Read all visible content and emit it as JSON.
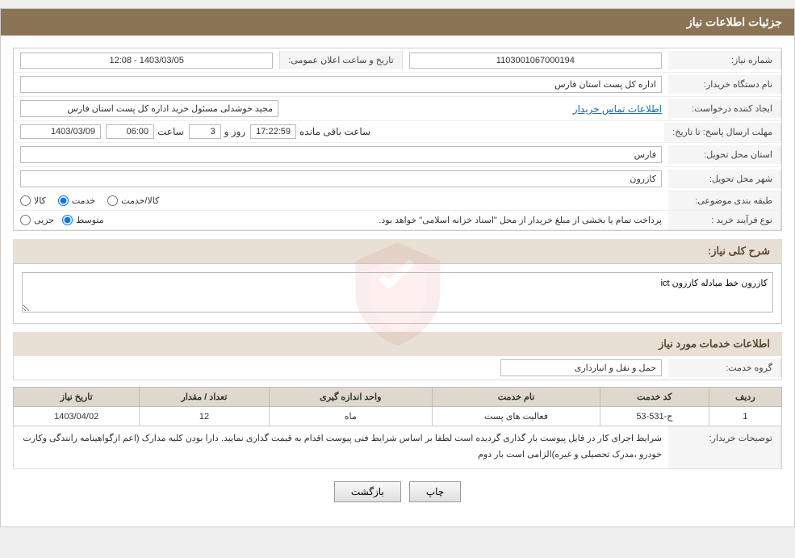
{
  "header": {
    "title": "جزئیات اطلاعات نیاز"
  },
  "fields": {
    "need_number_label": "شماره نیاز:",
    "need_number_value": "1103001067000194",
    "org_name_label": "نام دستگاه خریدار:",
    "org_name_value": "اداره کل پست استان فارس",
    "creator_label": "ایجاد کننده درخواست:",
    "creator_value": "مجید خوشدلی مسئول خرید اداره کل پست استان فارس",
    "contact_link": "اطلاعات تماس خریدار",
    "deadline_label": "مهلت ارسال پاسخ: تا تاریخ:",
    "deadline_date": "1403/03/09",
    "deadline_time_label": "ساعت",
    "deadline_time": "06:00",
    "deadline_days_label": "روز و",
    "deadline_days": "3",
    "deadline_remaining_label": "ساعت باقی مانده",
    "deadline_remaining": "17:22:59",
    "announce_label": "تاریخ و ساعت اعلان عمومی:",
    "announce_value": "1403/03/05 - 12:08",
    "province_label": "استان محل تحویل:",
    "province_value": "فارس",
    "city_label": "شهر محل تحویل:",
    "city_value": "کازرون",
    "category_label": "طبقه بندی موضوعی:",
    "category_options": [
      "کالا",
      "خدمت",
      "کالا/خدمت"
    ],
    "category_selected": "خدمت",
    "process_label": "نوع فرآیند خرید :",
    "process_options": [
      "جزیی",
      "متوسط"
    ],
    "process_note": "پرداخت تمام یا بخشی از مبلغ خریدار از محل \"اسناد خزانه اسلامی\" خواهد بود.",
    "need_desc_label": "شرح کلی نیاز:",
    "need_desc_value": "کازرون خط مبادله کازرون ict"
  },
  "service_section": {
    "title": "اطلاعات خدمات مورد نیاز",
    "group_label": "گروه خدمت:",
    "group_value": "حمل و نقل و انبارداری",
    "table": {
      "headers": [
        "ردیف",
        "کد خدمت",
        "نام خدمت",
        "واحد اندازه گیری",
        "تعداد / مقدار",
        "تاریخ نیاز"
      ],
      "rows": [
        {
          "row": "1",
          "code": "ح-531-53",
          "name": "فعالیت های پست",
          "unit": "ماه",
          "quantity": "12",
          "date": "1403/04/02"
        }
      ]
    }
  },
  "buyer_notes": {
    "label": "توصیحات خریدار:",
    "text": "شرایط اجرای کار در فایل پیوست بار گذاری گردیده است لطفا بر اساس شرایط فنی پیوست اقدام به قیمت گذاری نمایید. دارا بودن کلیه مدارک (اعم ازگواهینامه رانندگی وکارت خودرو ،مدرک تحصیلی و غیره)الزامی است بار دوم"
  },
  "buttons": {
    "back_label": "بازگشت",
    "print_label": "چاپ"
  }
}
